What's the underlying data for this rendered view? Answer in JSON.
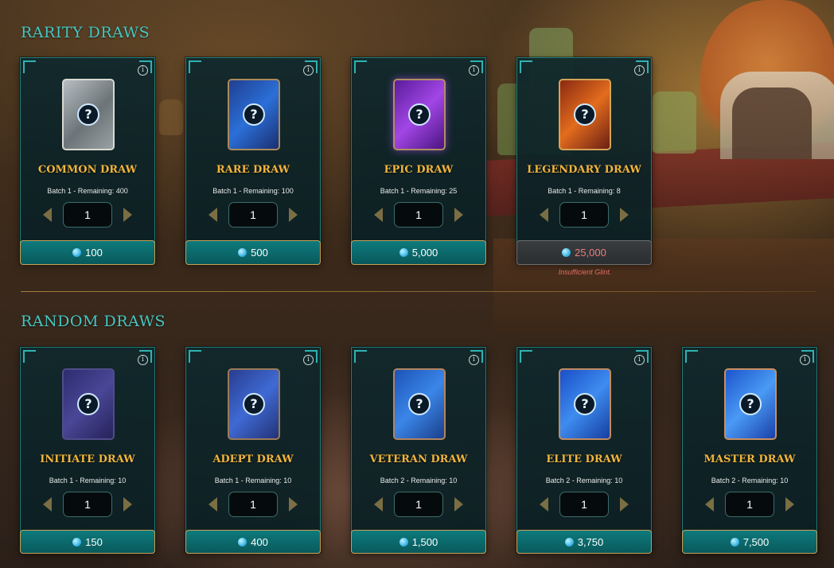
{
  "sections": {
    "rarity_title": "RARITY DRAWS",
    "random_title": "RANDOM DRAWS"
  },
  "rarity": [
    {
      "title": "COMMON DRAW",
      "remaining": "Batch 1 - Remaining: 400",
      "qty": "1",
      "price": "100"
    },
    {
      "title": "RARE DRAW",
      "remaining": "Batch 1 - Remaining: 100",
      "qty": "1",
      "price": "500"
    },
    {
      "title": "EPIC DRAW",
      "remaining": "Batch 1 - Remaining: 25",
      "qty": "1",
      "price": "5,000"
    },
    {
      "title": "LEGENDARY DRAW",
      "remaining": "Batch 1 - Remaining: 8",
      "qty": "1",
      "price": "25,000",
      "warning": "Insufficient Glint."
    }
  ],
  "random": [
    {
      "title": "INITIATE DRAW",
      "remaining": "Batch 1 - Remaining: 10",
      "qty": "1",
      "price": "150"
    },
    {
      "title": "ADEPT DRAW",
      "remaining": "Batch 1 - Remaining: 10",
      "qty": "1",
      "price": "400"
    },
    {
      "title": "VETERAN DRAW",
      "remaining": "Batch 2 - Remaining: 10",
      "qty": "1",
      "price": "1,500"
    },
    {
      "title": "ELITE DRAW",
      "remaining": "Batch 2 - Remaining: 10",
      "qty": "1",
      "price": "3,750"
    },
    {
      "title": "MASTER DRAW",
      "remaining": "Batch 2 - Remaining: 10",
      "qty": "1",
      "price": "7,500"
    }
  ],
  "icons": {
    "info": "i",
    "pack_question": "?",
    "currency": "glint-coin-icon",
    "decrease": "arrow-left-icon",
    "increase": "arrow-right-icon"
  },
  "colors": {
    "section_title": "#46c7c2",
    "card_title": "#f1b43c",
    "price_button": "#0e7a7c",
    "warning": "#e06d63"
  }
}
